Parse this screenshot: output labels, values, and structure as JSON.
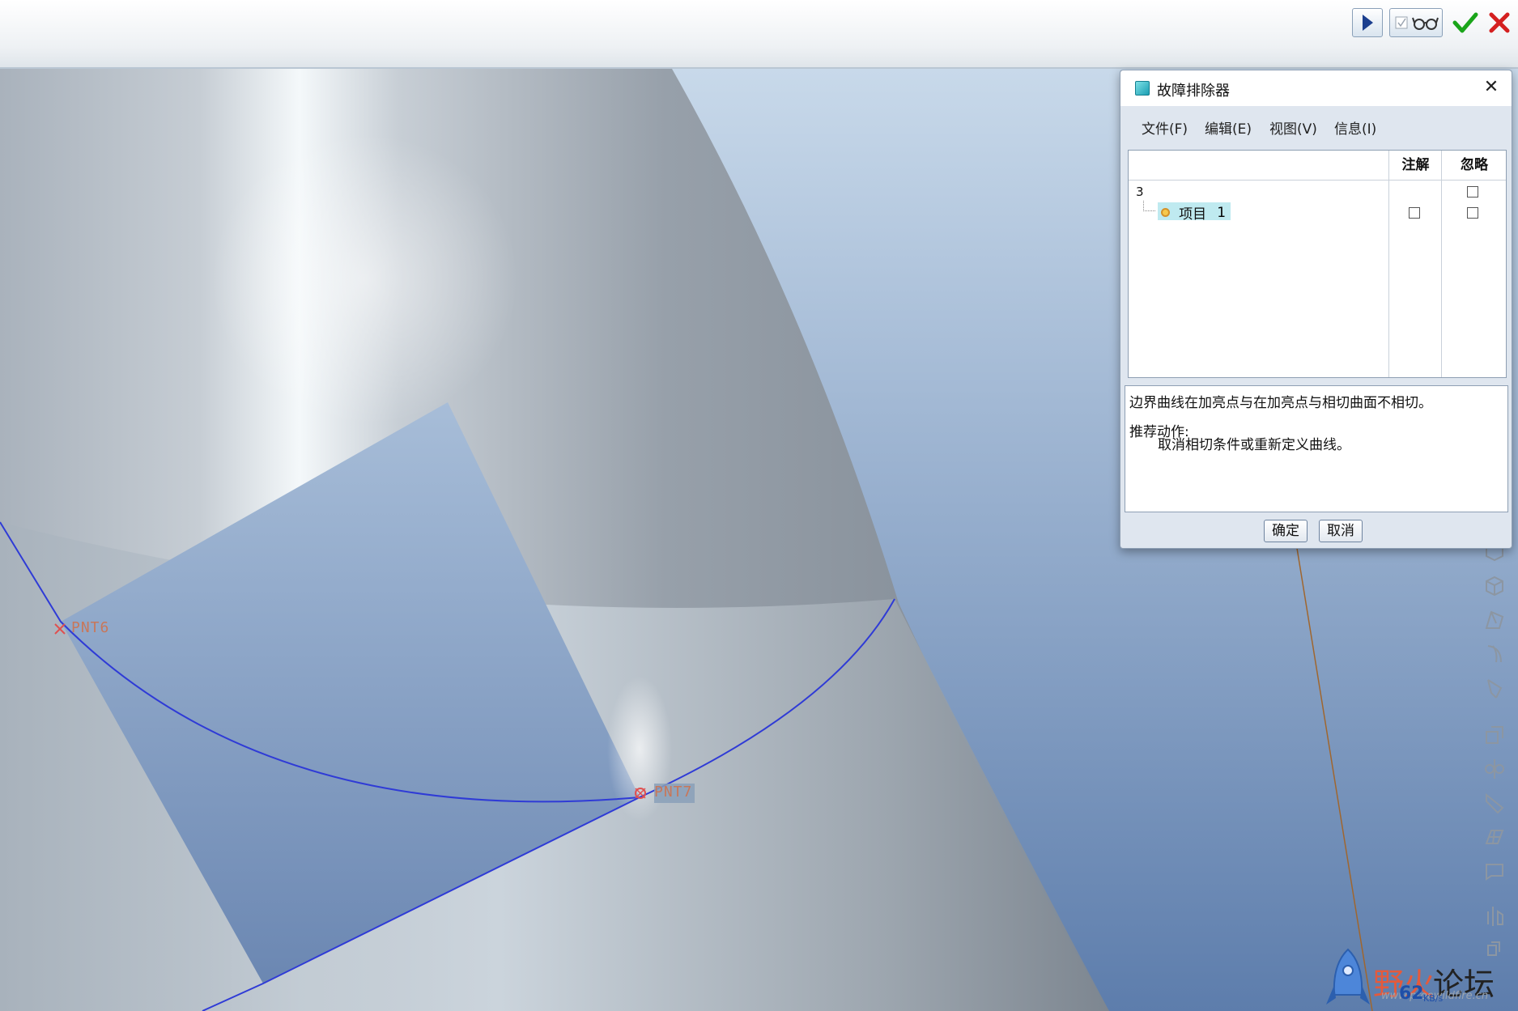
{
  "toolbar": {
    "buttons": [
      {
        "name": "play-icon"
      },
      {
        "name": "checkbox-icon"
      },
      {
        "name": "glasses-icon"
      },
      {
        "name": "checkmark-icon",
        "color": "#1aa51a"
      },
      {
        "name": "close-x-icon",
        "color": "#d42020"
      }
    ]
  },
  "viewport": {
    "points": [
      {
        "label": "PNT6"
      },
      {
        "label": "PNT7"
      }
    ],
    "curve_color": "#2f3bd6"
  },
  "dialog": {
    "title": "故障排除器",
    "menu": [
      "文件(F)",
      "编辑(E)",
      "视图(V)",
      "信息(I)"
    ],
    "columns": {
      "annotation": "注解",
      "ignore": "忽略"
    },
    "tree": {
      "group": "3",
      "item_label": "项目",
      "item_number": "1"
    },
    "message": "边界曲线在加亮点与在加亮点与相切曲面不相切。",
    "recommended_label": "推荐动作:",
    "recommended_action": "取消相切条件或重新定义曲线。",
    "ok_label": "确定",
    "cancel_label": "取消"
  },
  "watermark": {
    "text_a": "野火",
    "text_b": "论坛",
    "url": "www.proewildfire.cn",
    "speed": "62",
    "speed_unit": "KB/s"
  }
}
